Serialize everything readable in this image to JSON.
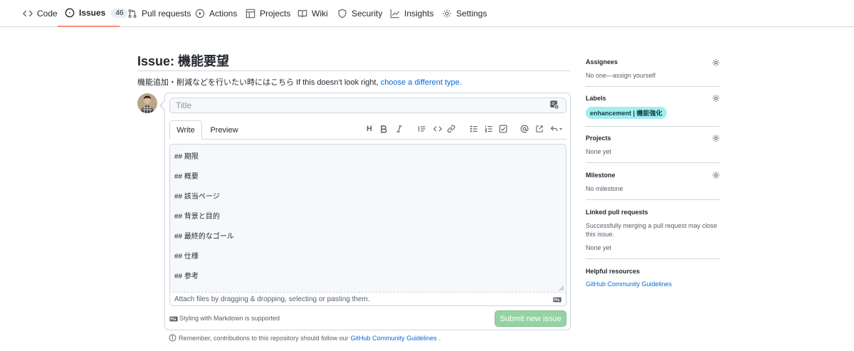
{
  "nav": {
    "tabs": [
      {
        "label": "Code",
        "icon": "code-icon"
      },
      {
        "label": "Issues",
        "icon": "issue-opened-icon",
        "count": "46"
      },
      {
        "label": "Pull requests",
        "icon": "git-pull-request-icon"
      },
      {
        "label": "Actions",
        "icon": "play-icon"
      },
      {
        "label": "Projects",
        "icon": "table-icon"
      },
      {
        "label": "Wiki",
        "icon": "book-icon"
      },
      {
        "label": "Security",
        "icon": "shield-icon"
      },
      {
        "label": "Insights",
        "icon": "graph-icon"
      },
      {
        "label": "Settings",
        "icon": "gear-icon"
      }
    ],
    "active": "Issues",
    "active_color": "#fd8c73"
  },
  "issue": {
    "page_title": "Issue: 機能要望",
    "subtitle_text": "機能追加・削減などを行いたい時にはこちら If this doesn’t look right,",
    "subtitle_link": "choose a different type."
  },
  "form": {
    "title_placeholder": "Title",
    "tabs": {
      "write": "Write",
      "preview": "Preview"
    },
    "toolbar": [
      "heading-icon",
      "bold-icon",
      "italic-icon",
      "quote-icon",
      "code-icon",
      "link-icon",
      "unordered-list-icon",
      "ordered-list-icon",
      "tasklist-icon",
      "mention-icon",
      "cross-reference-icon",
      "reply-icon"
    ],
    "toolbar_heading": "H",
    "body_lines": [
      "## 期限",
      "## 概要",
      "## 該当ページ",
      "## 背景と目的",
      "## 最終的なゴール",
      "## 仕様",
      "## 参考"
    ],
    "attach_text": "Attach files by dragging & dropping, selecting or pasting them.",
    "markdown_note": "Styling with Markdown is supported",
    "submit_label": "Submit new issue",
    "submit_color": "#94d3a2"
  },
  "footer": {
    "remember_text": "Remember, contributions to this repository should follow our",
    "remember_link": "GitHub Community Guidelines",
    "remember_end": "."
  },
  "sidebar": {
    "assignees": {
      "heading": "Assignees",
      "value": "No one—assign yourself"
    },
    "labels": {
      "heading": "Labels",
      "label": "enhancement | 機能強化",
      "label_color": "#a2eeef"
    },
    "projects": {
      "heading": "Projects",
      "value": "None yet"
    },
    "milestone": {
      "heading": "Milestone",
      "value": "No milestone"
    },
    "linked_prs": {
      "heading": "Linked pull requests",
      "description": "Successfully merging a pull request may close this issue.",
      "value": "None yet"
    },
    "helpful": {
      "heading": "Helpful resources",
      "link": "GitHub Community Guidelines"
    }
  },
  "colors": {
    "link": "#0969da",
    "border": "#d0d7de",
    "muted": "#57606a"
  }
}
